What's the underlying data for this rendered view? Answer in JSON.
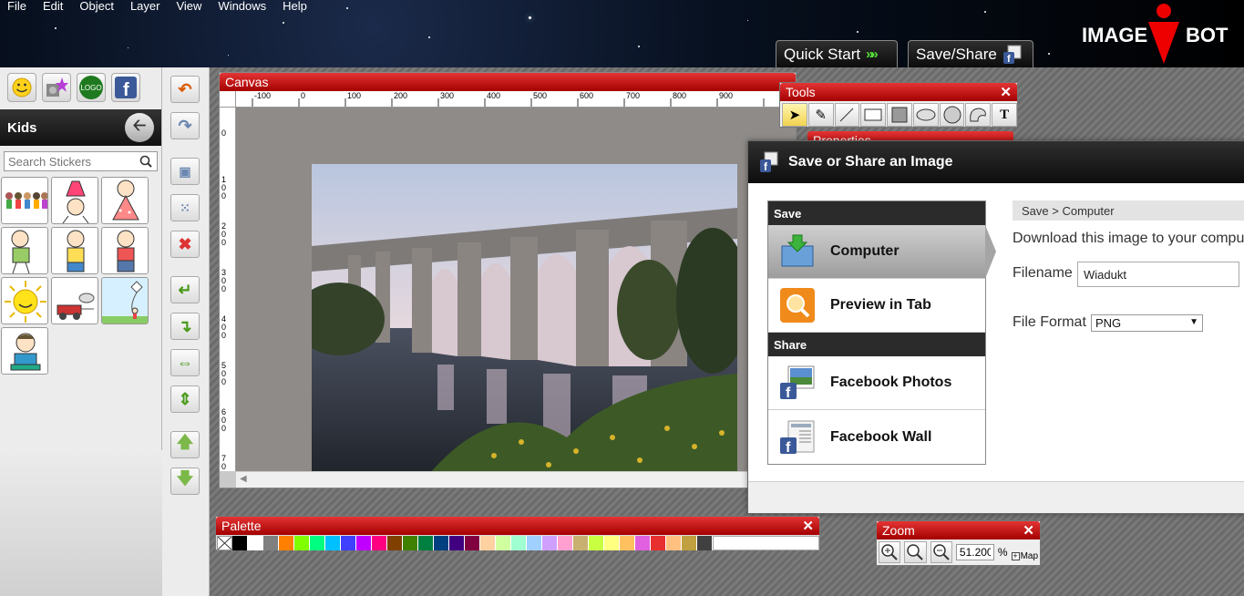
{
  "menu": [
    "File",
    "Edit",
    "Object",
    "Layer",
    "View",
    "Windows",
    "Help"
  ],
  "brand": {
    "left": "IMAGE",
    "right": "BOT"
  },
  "top_tabs": {
    "quick_start": "Quick Start",
    "save_share": "Save/Share"
  },
  "left_panel": {
    "category_buttons": [
      "smiley-icon",
      "star-icon",
      "logo-icon",
      "facebook-icon"
    ],
    "logo_button_text": "LOGO",
    "category_title": "Kids",
    "search_placeholder": "Search Stickers"
  },
  "canvas_window": {
    "title": "Canvas",
    "ruler_h": [
      "-100",
      "0",
      "100",
      "200",
      "300",
      "400",
      "500",
      "600",
      "700",
      "800",
      "900"
    ],
    "ruler_v": [
      "0",
      "100",
      "200",
      "300",
      "400",
      "500",
      "600",
      "700"
    ]
  },
  "tools_window": {
    "title": "Tools",
    "close": "✕"
  },
  "properties_window": {
    "title": "Properties"
  },
  "dialog": {
    "title": "Save or Share an Image",
    "save_section": "Save",
    "share_section": "Share",
    "options": {
      "computer": "Computer",
      "preview": "Preview in Tab",
      "fb_photos": "Facebook Photos",
      "fb_wall": "Facebook Wall"
    },
    "breadcrumb": "Save > Computer",
    "description": "Download this image to your compu",
    "filename_label": "Filename",
    "filename_value": "Wiadukt",
    "format_label": "File Format",
    "format_value": "PNG"
  },
  "palette_window": {
    "title": "Palette",
    "close": "✕"
  },
  "palette_colors": [
    "#000000",
    "#ffffff",
    "#7f7f7f",
    "#ff7f00",
    "#80ff00",
    "#00ff80",
    "#00c0ff",
    "#4040ff",
    "#c000ff",
    "#ff0080",
    "#7f4000",
    "#408000",
    "#008040",
    "#004080",
    "#400080",
    "#800040",
    "#ffd0a0",
    "#d0ffa0",
    "#a0ffd0",
    "#a0d0ff",
    "#d0a0ff",
    "#ffa0d0",
    "#c8b070",
    "#c8ff40",
    "#ffff80",
    "#ffc060",
    "#e060e0",
    "#e83030",
    "#ffc080",
    "#c0a040",
    "#404040"
  ],
  "zoom_window": {
    "title": "Zoom",
    "close": "✕",
    "value": "51.200",
    "percent": "%",
    "map_label": "Map"
  }
}
